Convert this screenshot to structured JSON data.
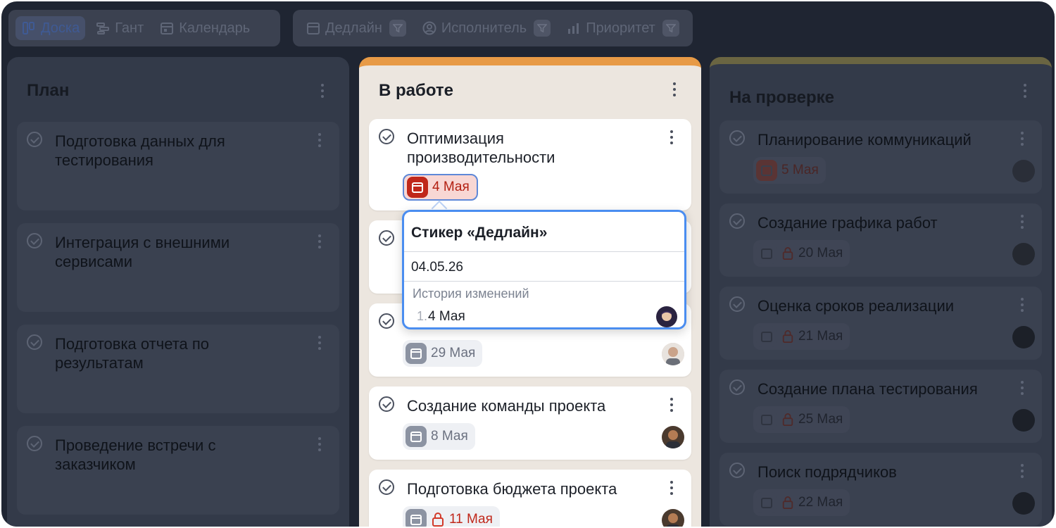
{
  "toolbar": {
    "views": [
      {
        "label": "Доска",
        "icon": "board-icon",
        "active": true
      },
      {
        "label": "Гант",
        "icon": "gantt-icon",
        "active": false
      },
      {
        "label": "Календарь",
        "icon": "calendar-icon",
        "active": false
      }
    ],
    "filters": [
      {
        "label": "Дедлайн",
        "icon": "calendar-icon"
      },
      {
        "label": "Исполнитель",
        "icon": "user-circle-icon"
      },
      {
        "label": "Приоритет",
        "icon": "priority-bars-icon"
      }
    ]
  },
  "columns": {
    "plan": {
      "title": "План",
      "cards": [
        {
          "title": "Подготовка данных для тестирования"
        },
        {
          "title": "Интеграция с внешними сервисами"
        },
        {
          "title": "Подготовка отчета по результатам"
        },
        {
          "title": "Проведение встречи с заказчиком"
        }
      ]
    },
    "in_progress": {
      "title": "В работе",
      "accent": "#e79a46",
      "cards": [
        {
          "title": "Оптимизация производительности",
          "date": "4 Мая",
          "overdue": true
        },
        {
          "title": "",
          "date": "",
          "hidden": true
        },
        {
          "title": "",
          "date": "29 Мая"
        },
        {
          "title": "Создание команды проекта",
          "date": "8 Мая"
        },
        {
          "title": "Подготовка бюджета проекта",
          "date": "11 Мая",
          "locked": true
        }
      ]
    },
    "review": {
      "title": "На проверке",
      "cards": [
        {
          "title": "Планирование коммуникаций",
          "date": "5 Мая"
        },
        {
          "title": "Создание графика работ",
          "date": "20 Мая",
          "locked": true
        },
        {
          "title": "Оценка сроков реализации",
          "date": "21 Мая",
          "locked": true
        },
        {
          "title": "Создание плана тестирования",
          "date": "25 Мая",
          "locked": true
        },
        {
          "title": "Поиск подрядчиков",
          "date": "22 Мая",
          "locked": true
        }
      ]
    }
  },
  "popup": {
    "title": "Стикер «Дедлайн»",
    "value": "04.05.26",
    "history_label": "История изменений",
    "history": [
      {
        "index": "1.",
        "value": "4 Мая"
      }
    ]
  },
  "colors": {
    "accent_orange": "#e79a46",
    "overdue_red": "#c0271a",
    "focus_blue": "#4a8df0"
  }
}
